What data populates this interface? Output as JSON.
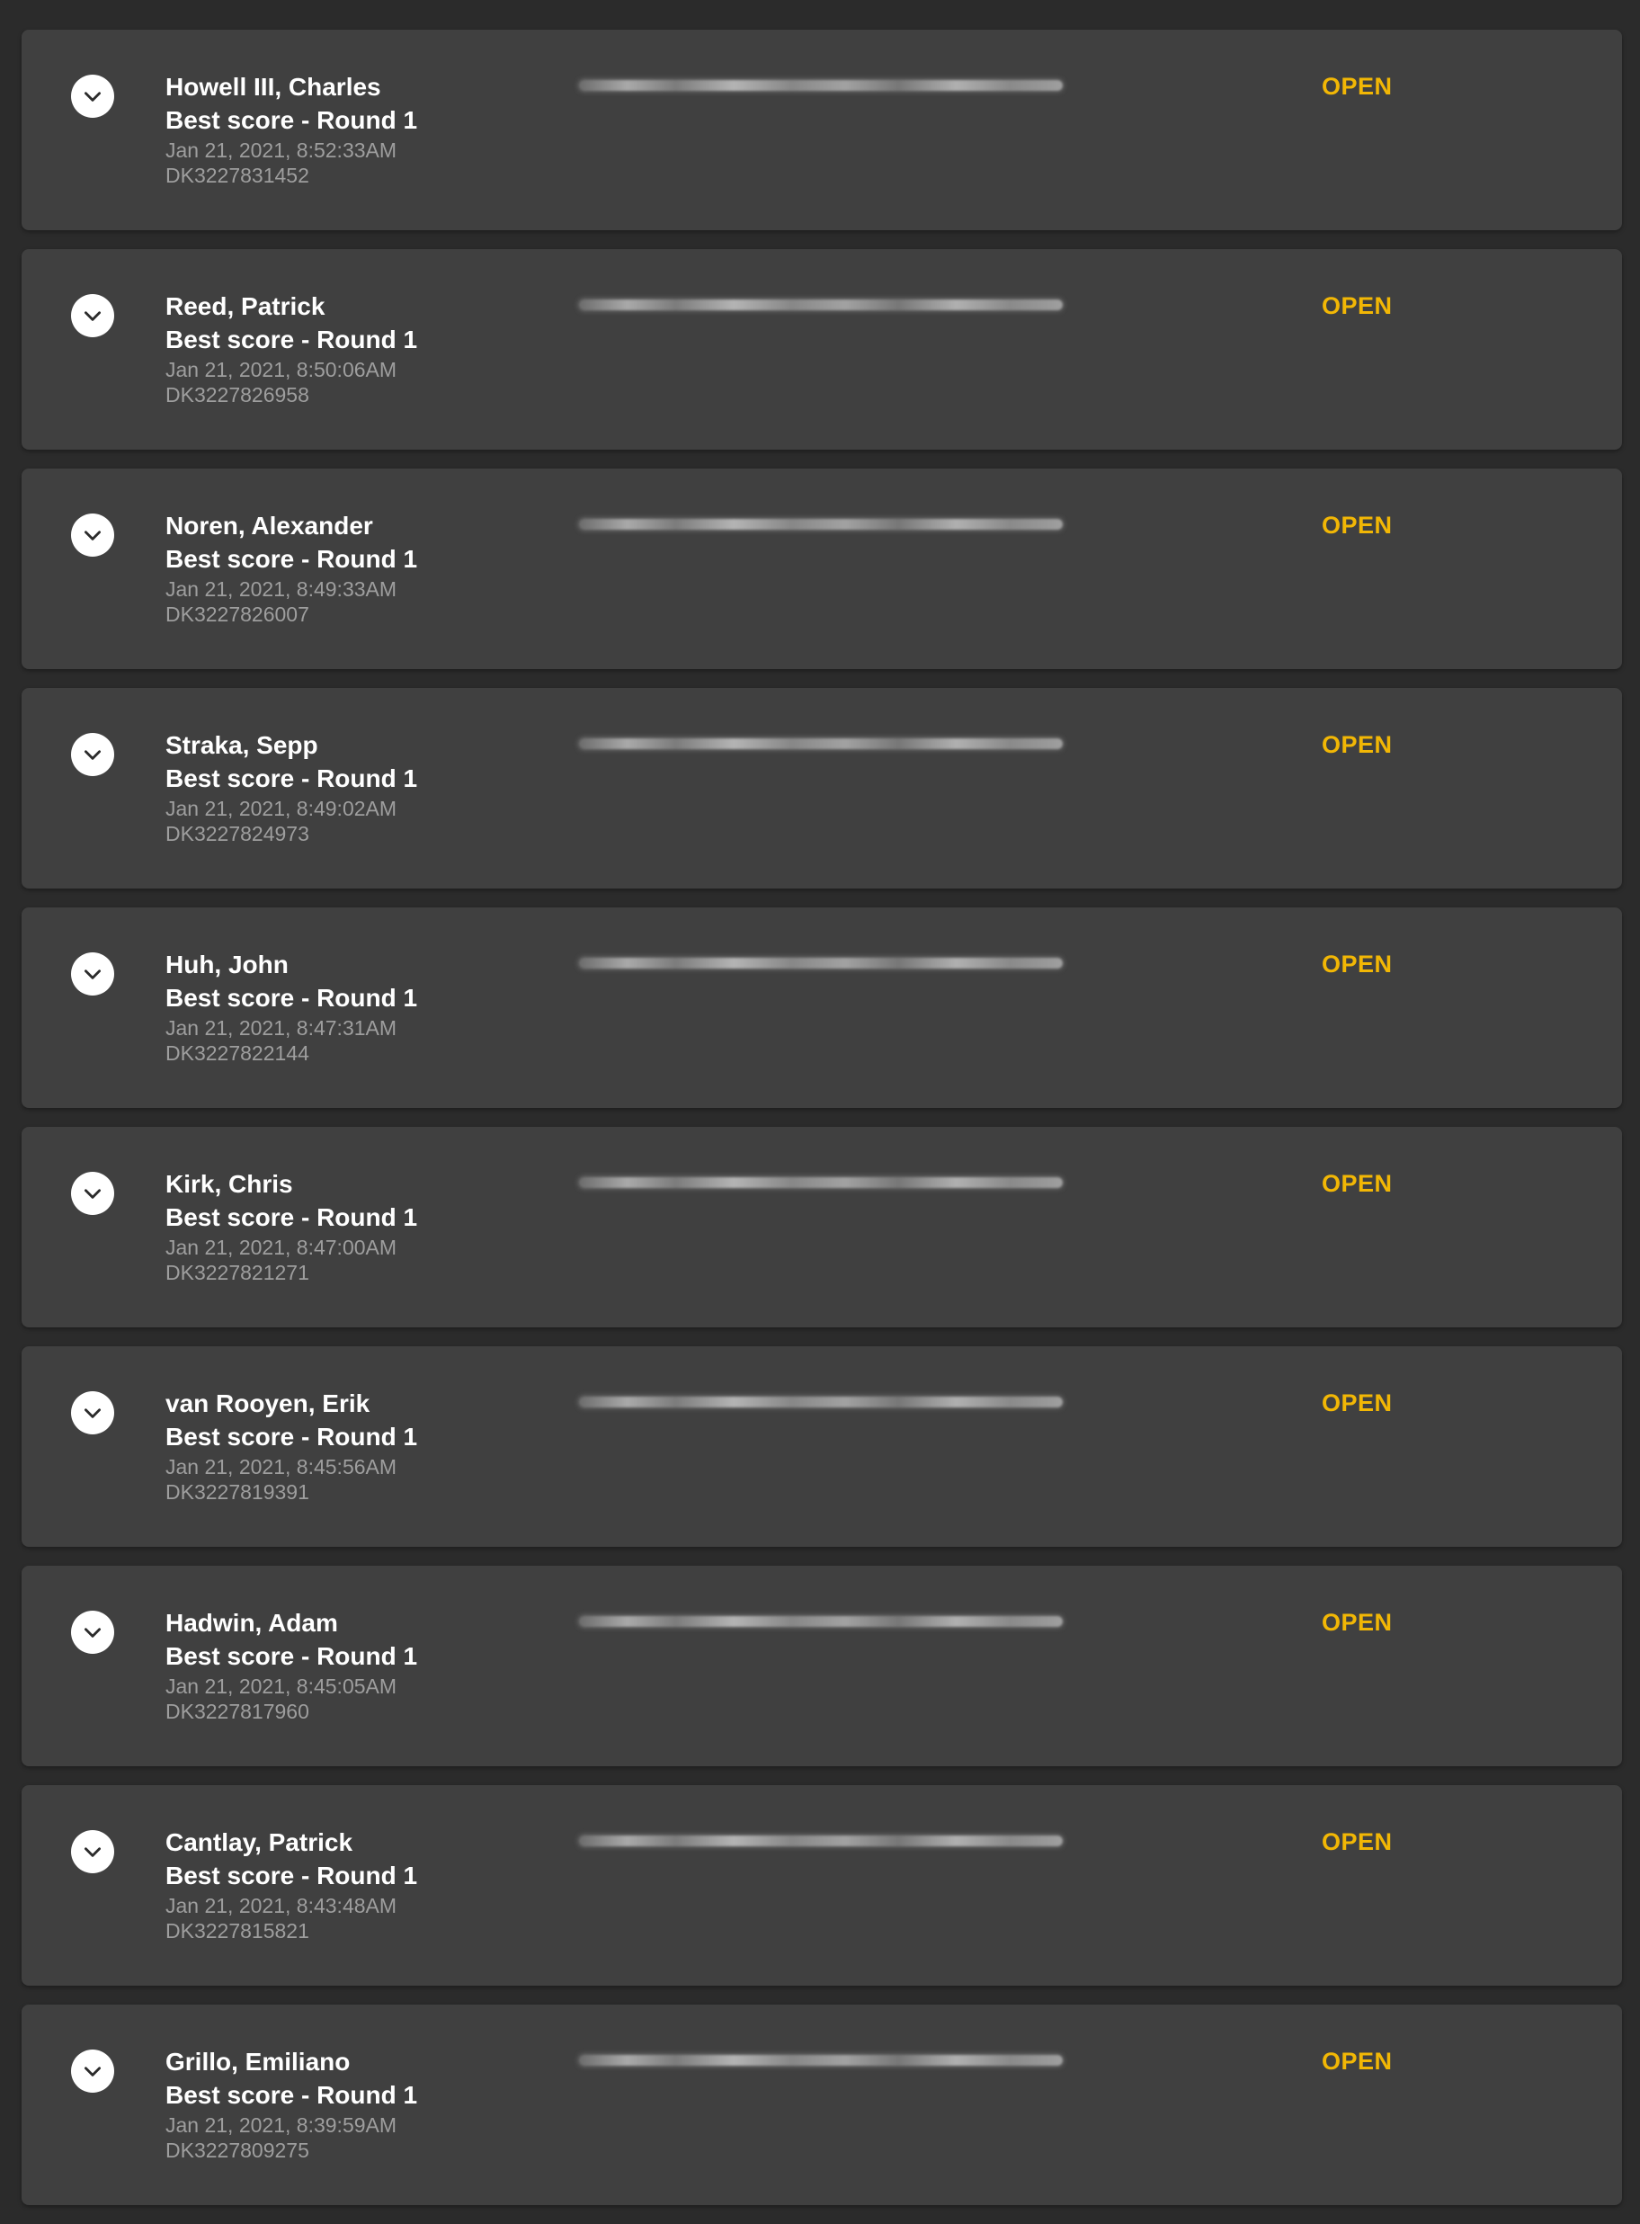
{
  "bets": [
    {
      "player": "Howell III, Charles",
      "bet_type": "Best score - Round 1",
      "timestamp": "Jan 21, 2021, 8:52:33AM",
      "bet_id": "DK3227831452",
      "status": "OPEN"
    },
    {
      "player": "Reed, Patrick",
      "bet_type": "Best score - Round 1",
      "timestamp": "Jan 21, 2021, 8:50:06AM",
      "bet_id": "DK3227826958",
      "status": "OPEN"
    },
    {
      "player": "Noren, Alexander",
      "bet_type": "Best score - Round 1",
      "timestamp": "Jan 21, 2021, 8:49:33AM",
      "bet_id": "DK3227826007",
      "status": "OPEN"
    },
    {
      "player": "Straka, Sepp",
      "bet_type": "Best score - Round 1",
      "timestamp": "Jan 21, 2021, 8:49:02AM",
      "bet_id": "DK3227824973",
      "status": "OPEN"
    },
    {
      "player": "Huh, John",
      "bet_type": "Best score - Round 1",
      "timestamp": "Jan 21, 2021, 8:47:31AM",
      "bet_id": "DK3227822144",
      "status": "OPEN"
    },
    {
      "player": "Kirk, Chris",
      "bet_type": "Best score - Round 1",
      "timestamp": "Jan 21, 2021, 8:47:00AM",
      "bet_id": "DK3227821271",
      "status": "OPEN"
    },
    {
      "player": "van Rooyen, Erik",
      "bet_type": "Best score - Round 1",
      "timestamp": "Jan 21, 2021, 8:45:56AM",
      "bet_id": "DK3227819391",
      "status": "OPEN"
    },
    {
      "player": "Hadwin, Adam",
      "bet_type": "Best score - Round 1",
      "timestamp": "Jan 21, 2021, 8:45:05AM",
      "bet_id": "DK3227817960",
      "status": "OPEN"
    },
    {
      "player": "Cantlay, Patrick",
      "bet_type": "Best score - Round 1",
      "timestamp": "Jan 21, 2021, 8:43:48AM",
      "bet_id": "DK3227815821",
      "status": "OPEN"
    },
    {
      "player": "Grillo, Emiliano",
      "bet_type": "Best score - Round 1",
      "timestamp": "Jan 21, 2021, 8:39:59AM",
      "bet_id": "DK3227809275",
      "status": "OPEN"
    }
  ],
  "icons": {
    "expand": "chevron-down-icon"
  },
  "colors": {
    "page_background": "#2b2b2b",
    "card_background": "#404040",
    "status_open": "#f2b705",
    "primary_text": "#ffffff",
    "secondary_text": "#9e9e9e"
  }
}
